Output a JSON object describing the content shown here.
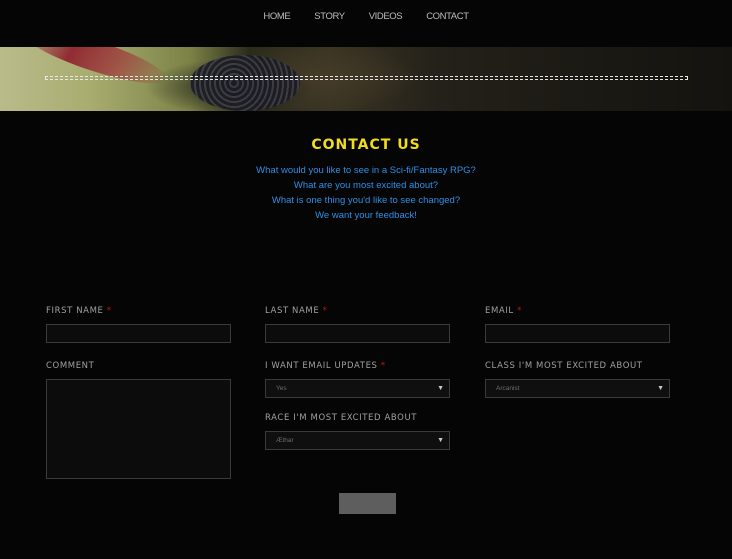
{
  "nav": {
    "items": [
      "HOME",
      "STORY",
      "VIDEOS",
      "CONTACT"
    ]
  },
  "contact": {
    "heading": "CONTACT US",
    "intro": [
      "What would you like to see in a Sci-fi/Fantasy RPG?",
      "What are you most excited about?",
      "What is one thing you'd like to see changed?",
      "We want your feedback!"
    ]
  },
  "form": {
    "first_name_label": "FIRST NAME",
    "last_name_label": "LAST NAME",
    "email_label": "EMAIL",
    "comment_label": "COMMENT",
    "email_updates_label": "I WANT EMAIL UPDATES",
    "class_label": "CLASS I'M MOST EXCITED ABOUT",
    "race_label": "RACE I'M MOST EXCITED ABOUT",
    "required_marker": "*",
    "email_updates_value": "Yes",
    "class_value": "Arcanist",
    "race_value": "Æthar",
    "dropdown_arrow": "▼"
  },
  "colors": {
    "background": "#050505",
    "heading": "#f2dc1d",
    "intro_text": "#2f8fe6",
    "required": "#c01818",
    "submit_button": "#5e5e5e"
  },
  "icons": {
    "dropdown": "chevron-down-icon"
  }
}
